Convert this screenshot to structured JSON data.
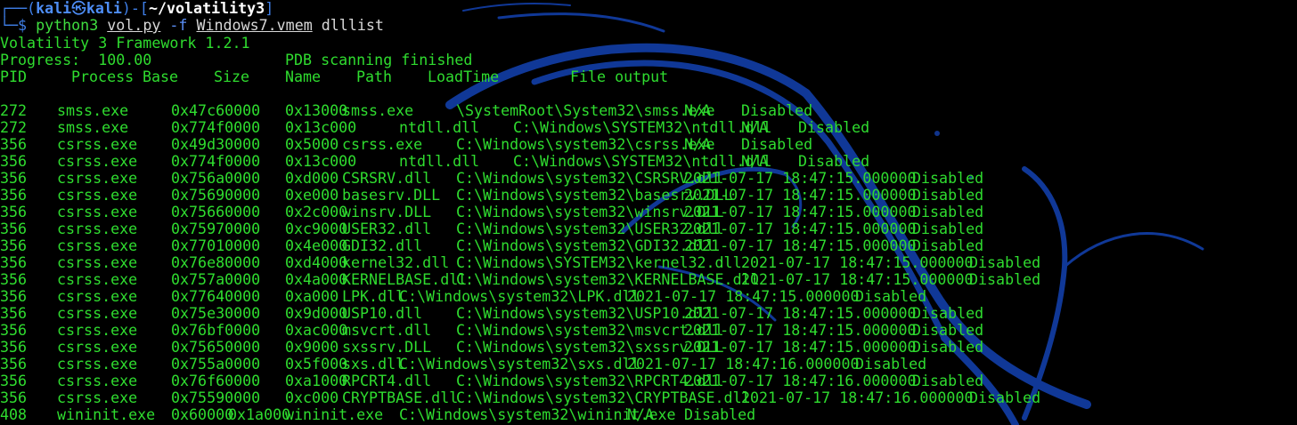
{
  "prompt": {
    "corner_top": "┌──(",
    "user": "kali",
    "at_symbol": "㉿",
    "host": "kali",
    "path_open": ")-[",
    "cwd": "~/volatility3",
    "path_close": "]",
    "corner_bottom": "└─$ ",
    "command": "python3",
    "script": "vol.py",
    "flag": "-f",
    "image_file": "Windows7.vmem",
    "plugin": "dlllist"
  },
  "output": {
    "framework": "Volatility 3 Framework 1.2.1",
    "progress_label": "Progress:  100.00",
    "progress_status": "PDB scanning finished",
    "headers": [
      "PID",
      "Process",
      "Base",
      "Size",
      "Name",
      "Path",
      "LoadTime",
      "File output"
    ],
    "rows": [
      {
        "pid": "272",
        "process": "smss.exe",
        "base": "0x47c60000",
        "size": "0x13000",
        "name": "smss.exe",
        "path": "\\SystemRoot\\System32\\smss.exe",
        "loadtime": "N/A",
        "output": "Disabled"
      },
      {
        "pid": "272",
        "process": "smss.exe",
        "base": "0x774f0000",
        "size": "0x13c000",
        "name": "ntdll.dll",
        "path": "C:\\Windows\\SYSTEM32\\ntdll.dll",
        "loadtime": "N/A",
        "output": "Disabled"
      },
      {
        "pid": "356",
        "process": "csrss.exe",
        "base": "0x49d30000",
        "size": "0x5000",
        "name": "csrss.exe",
        "path": "C:\\Windows\\system32\\csrss.exe",
        "loadtime": "N/A",
        "output": "Disabled"
      },
      {
        "pid": "356",
        "process": "csrss.exe",
        "base": "0x774f0000",
        "size": "0x13c000",
        "name": "ntdll.dll",
        "path": "C:\\Windows\\SYSTEM32\\ntdll.dll",
        "loadtime": "N/A",
        "output": "Disabled"
      },
      {
        "pid": "356",
        "process": "csrss.exe",
        "base": "0x756a0000",
        "size": "0xd000",
        "name": "CSRSRV.dll",
        "path": "C:\\Windows\\system32\\CSRSRV.dll",
        "loadtime": "2021-07-17 18:47:15.000000",
        "output": "Disabled"
      },
      {
        "pid": "356",
        "process": "csrss.exe",
        "base": "0x75690000",
        "size": "0xe000",
        "name": "basesrv.DLL",
        "path": "C:\\Windows\\system32\\basesrv.DLL",
        "loadtime": "2021-07-17 18:47:15.000000",
        "output": "Disabled"
      },
      {
        "pid": "356",
        "process": "csrss.exe",
        "base": "0x75660000",
        "size": "0x2c000",
        "name": "winsrv.DLL",
        "path": "C:\\Windows\\system32\\winsrv.DLL",
        "loadtime": "2021-07-17 18:47:15.000000",
        "output": "Disabled"
      },
      {
        "pid": "356",
        "process": "csrss.exe",
        "base": "0x75970000",
        "size": "0xc9000",
        "name": "USER32.dll",
        "path": "C:\\Windows\\system32\\USER32.dll",
        "loadtime": "2021-07-17 18:47:15.000000",
        "output": "Disabled"
      },
      {
        "pid": "356",
        "process": "csrss.exe",
        "base": "0x77010000",
        "size": "0x4e000",
        "name": "GDI32.dll",
        "path": "C:\\Windows\\system32\\GDI32.dll",
        "loadtime": "2021-07-17 18:47:15.000000",
        "output": "Disabled"
      },
      {
        "pid": "356",
        "process": "csrss.exe",
        "base": "0x76e80000",
        "size": "0xd4000",
        "name": "kernel32.dll",
        "path": "C:\\Windows\\SYSTEM32\\kernel32.dll",
        "loadtime": "2021-07-17 18:47:15.000000",
        "output": "Disabled"
      },
      {
        "pid": "356",
        "process": "csrss.exe",
        "base": "0x757a0000",
        "size": "0x4a000",
        "name": "KERNELBASE.dll",
        "path": "C:\\Windows\\system32\\KERNELBASE.dll",
        "loadtime": "2021-07-17 18:47:15.000000",
        "output": "Disabled"
      },
      {
        "pid": "356",
        "process": "csrss.exe",
        "base": "0x77640000",
        "size": "0xa000",
        "name": "LPK.dll",
        "path": "C:\\Windows\\system32\\LPK.dll",
        "loadtime": "2021-07-17 18:47:15.000000",
        "output": "Disabled"
      },
      {
        "pid": "356",
        "process": "csrss.exe",
        "base": "0x75e30000",
        "size": "0x9d000",
        "name": "USP10.dll",
        "path": "C:\\Windows\\system32\\USP10.dll",
        "loadtime": "2021-07-17 18:47:15.000000",
        "output": "Disabled"
      },
      {
        "pid": "356",
        "process": "csrss.exe",
        "base": "0x76bf0000",
        "size": "0xac000",
        "name": "msvcrt.dll",
        "path": "C:\\Windows\\system32\\msvcrt.dll",
        "loadtime": "2021-07-17 18:47:15.000000",
        "output": "Disabled"
      },
      {
        "pid": "356",
        "process": "csrss.exe",
        "base": "0x75650000",
        "size": "0x9000",
        "name": "sxssrv.DLL",
        "path": "C:\\Windows\\system32\\sxssrv.DLL",
        "loadtime": "2021-07-17 18:47:15.000000",
        "output": "Disabled"
      },
      {
        "pid": "356",
        "process": "csrss.exe",
        "base": "0x755a0000",
        "size": "0x5f000",
        "name": "sxs.dll",
        "path": "C:\\Windows\\system32\\sxs.dll",
        "loadtime": "2021-07-17 18:47:16.000000",
        "output": "Disabled"
      },
      {
        "pid": "356",
        "process": "csrss.exe",
        "base": "0x76f60000",
        "size": "0xa1000",
        "name": "RPCRT4.dll",
        "path": "C:\\Windows\\system32\\RPCRT4.dll",
        "loadtime": "2021-07-17 18:47:16.000000",
        "output": "Disabled"
      },
      {
        "pid": "356",
        "process": "csrss.exe",
        "base": "0x75590000",
        "size": "0xc000",
        "name": "CRYPTBASE.dll",
        "path": "C:\\Windows\\system32\\CRYPTBASE.dll",
        "loadtime": "2021-07-17 18:47:16.000000",
        "output": "Disabled"
      },
      {
        "pid": "408",
        "process": "wininit.exe",
        "base": "0x60000",
        "size": "0x1a000",
        "name": "wininit.exe",
        "path": "C:\\Windows\\system32\\wininit.exe",
        "loadtime": "N/A",
        "output": "Disabled"
      }
    ]
  }
}
